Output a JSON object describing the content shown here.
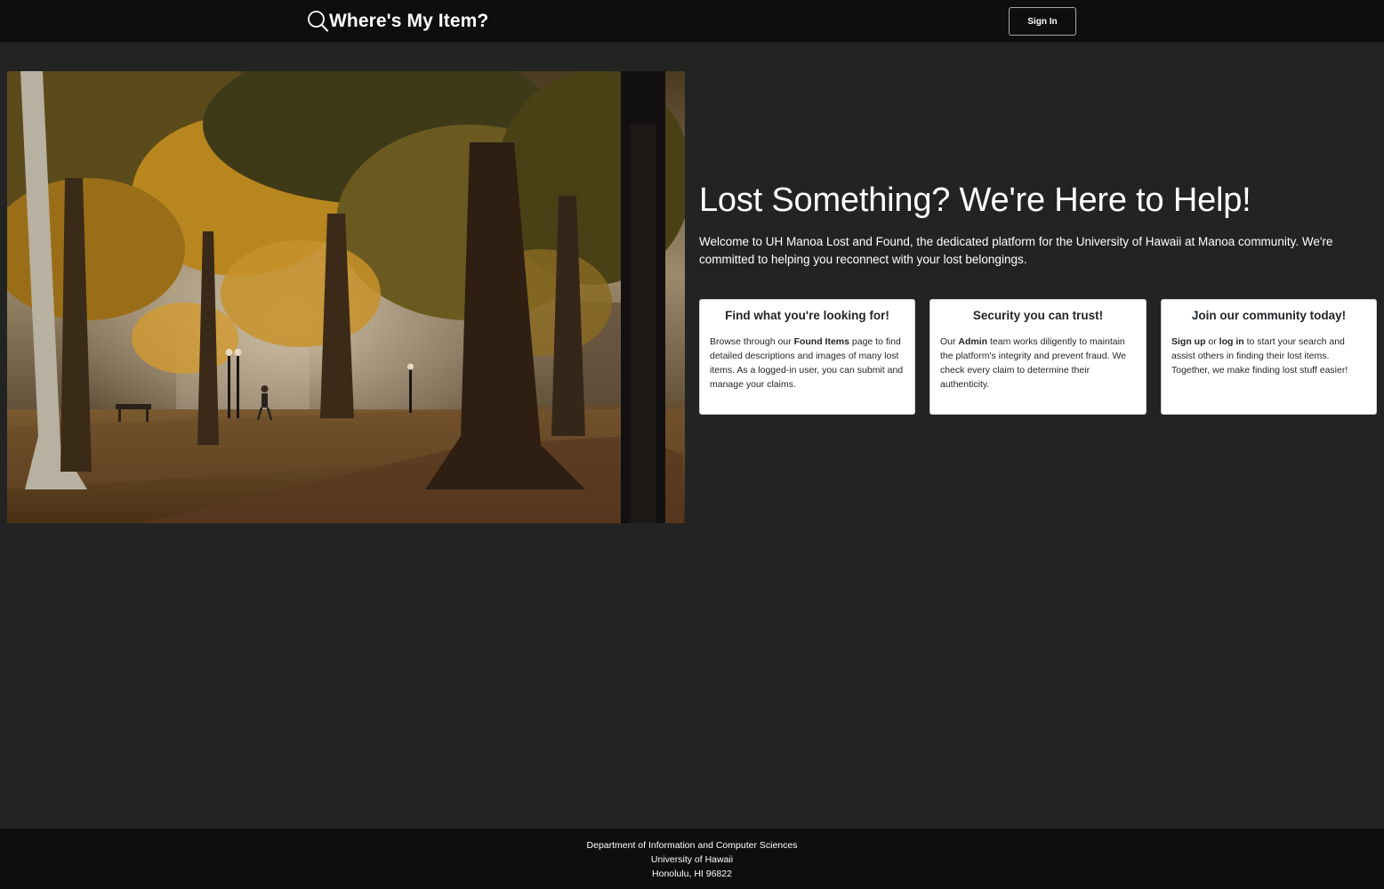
{
  "header": {
    "title": "Where's My Item?",
    "signin_label": "Sign In"
  },
  "hero": {
    "title": "Lost Something? We're Here to Help!",
    "description": "Welcome to UH Manoa Lost and Found, the dedicated platform for the University of Hawaii at Manoa community. We're committed to helping you reconnect with your lost belongings."
  },
  "cards": [
    {
      "title": "Find what you're looking for!",
      "body_parts": [
        "Browse through our ",
        "Found Items",
        " page to find detailed descriptions and images of many lost items. As a logged-in user, you can submit and manage your claims."
      ]
    },
    {
      "title": "Security you can trust!",
      "body_parts": [
        "Our ",
        "Admin",
        " team works diligently to maintain the platform's integrity and prevent fraud. We check every claim to determine their authenticity."
      ]
    },
    {
      "title": "Join our community today!",
      "body_parts": [
        "Sign up",
        " or ",
        "log in",
        " to start your search and assist others in finding their lost items. Together, we make finding lost stuff easier!"
      ]
    }
  ],
  "footer": {
    "line1": "Department of Information and Computer Sciences",
    "line2": "University of Hawaii",
    "line3": "Honolulu, HI 96822"
  },
  "colors": {
    "page_bg": "#232323",
    "navbar_bg": "#0e0e0e",
    "card_bg": "#ffffff",
    "text_light": "#ffffff"
  },
  "icons": {
    "brand": "search-icon"
  }
}
